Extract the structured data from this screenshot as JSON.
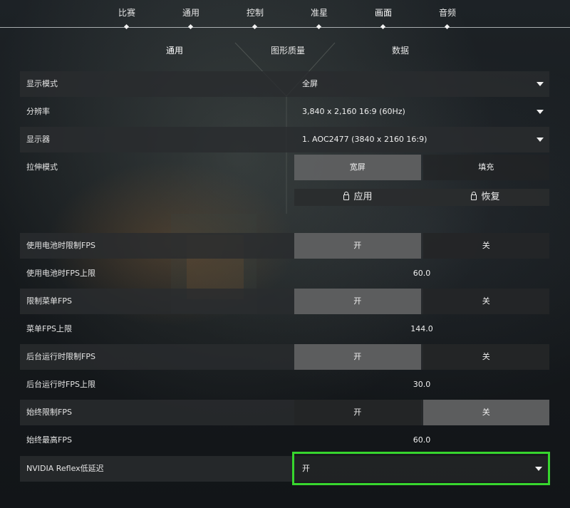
{
  "topnav": {
    "items": [
      {
        "label": "比赛"
      },
      {
        "label": "通用"
      },
      {
        "label": "控制"
      },
      {
        "label": "准星"
      },
      {
        "label": "画面",
        "active": true
      },
      {
        "label": "音频"
      }
    ]
  },
  "subtabs": [
    {
      "label": "通用",
      "active": true
    },
    {
      "label": "图形质量"
    },
    {
      "label": "数据"
    }
  ],
  "settings": {
    "display_mode": {
      "label": "显示模式",
      "value": "全屏"
    },
    "resolution": {
      "label": "分辨率",
      "value": "3,840 x 2,160 16:9 (60Hz)"
    },
    "monitor": {
      "label": "显示器",
      "value": "1. AOC2477 (3840 x  2160 16:9)"
    },
    "stretch_mode": {
      "label": "拉伸模式",
      "options": [
        "宽屏",
        "填充"
      ],
      "selected": "宽屏"
    },
    "apply_label": "应用",
    "restore_label": "恢复",
    "battery_limit_fps": {
      "label": "使用电池时限制FPS",
      "options": [
        "开",
        "关"
      ],
      "selected": "开"
    },
    "battery_fps_cap": {
      "label": "使用电池时FPS上限",
      "value": "60.0"
    },
    "menu_limit_fps": {
      "label": "限制菜单FPS",
      "options": [
        "开",
        "关"
      ],
      "selected": "开"
    },
    "menu_fps_cap": {
      "label": "菜单FPS上限",
      "value": "144.0"
    },
    "background_limit_fps": {
      "label": "后台运行时限制FPS",
      "options": [
        "开",
        "关"
      ],
      "selected": "开"
    },
    "background_fps_cap": {
      "label": "后台运行时FPS上限",
      "value": "30.0"
    },
    "always_limit_fps": {
      "label": "始终限制FPS",
      "options": [
        "开",
        "关"
      ],
      "selected": "关"
    },
    "always_max_fps": {
      "label": "始终最高FPS",
      "value": "60.0"
    },
    "nvidia_reflex": {
      "label": "NVIDIA Reflex低延迟",
      "value": "开"
    }
  },
  "colors": {
    "highlight_border": "#37d62e",
    "row_shade": "#2a2c2e",
    "selected_option": "#5f6061"
  }
}
